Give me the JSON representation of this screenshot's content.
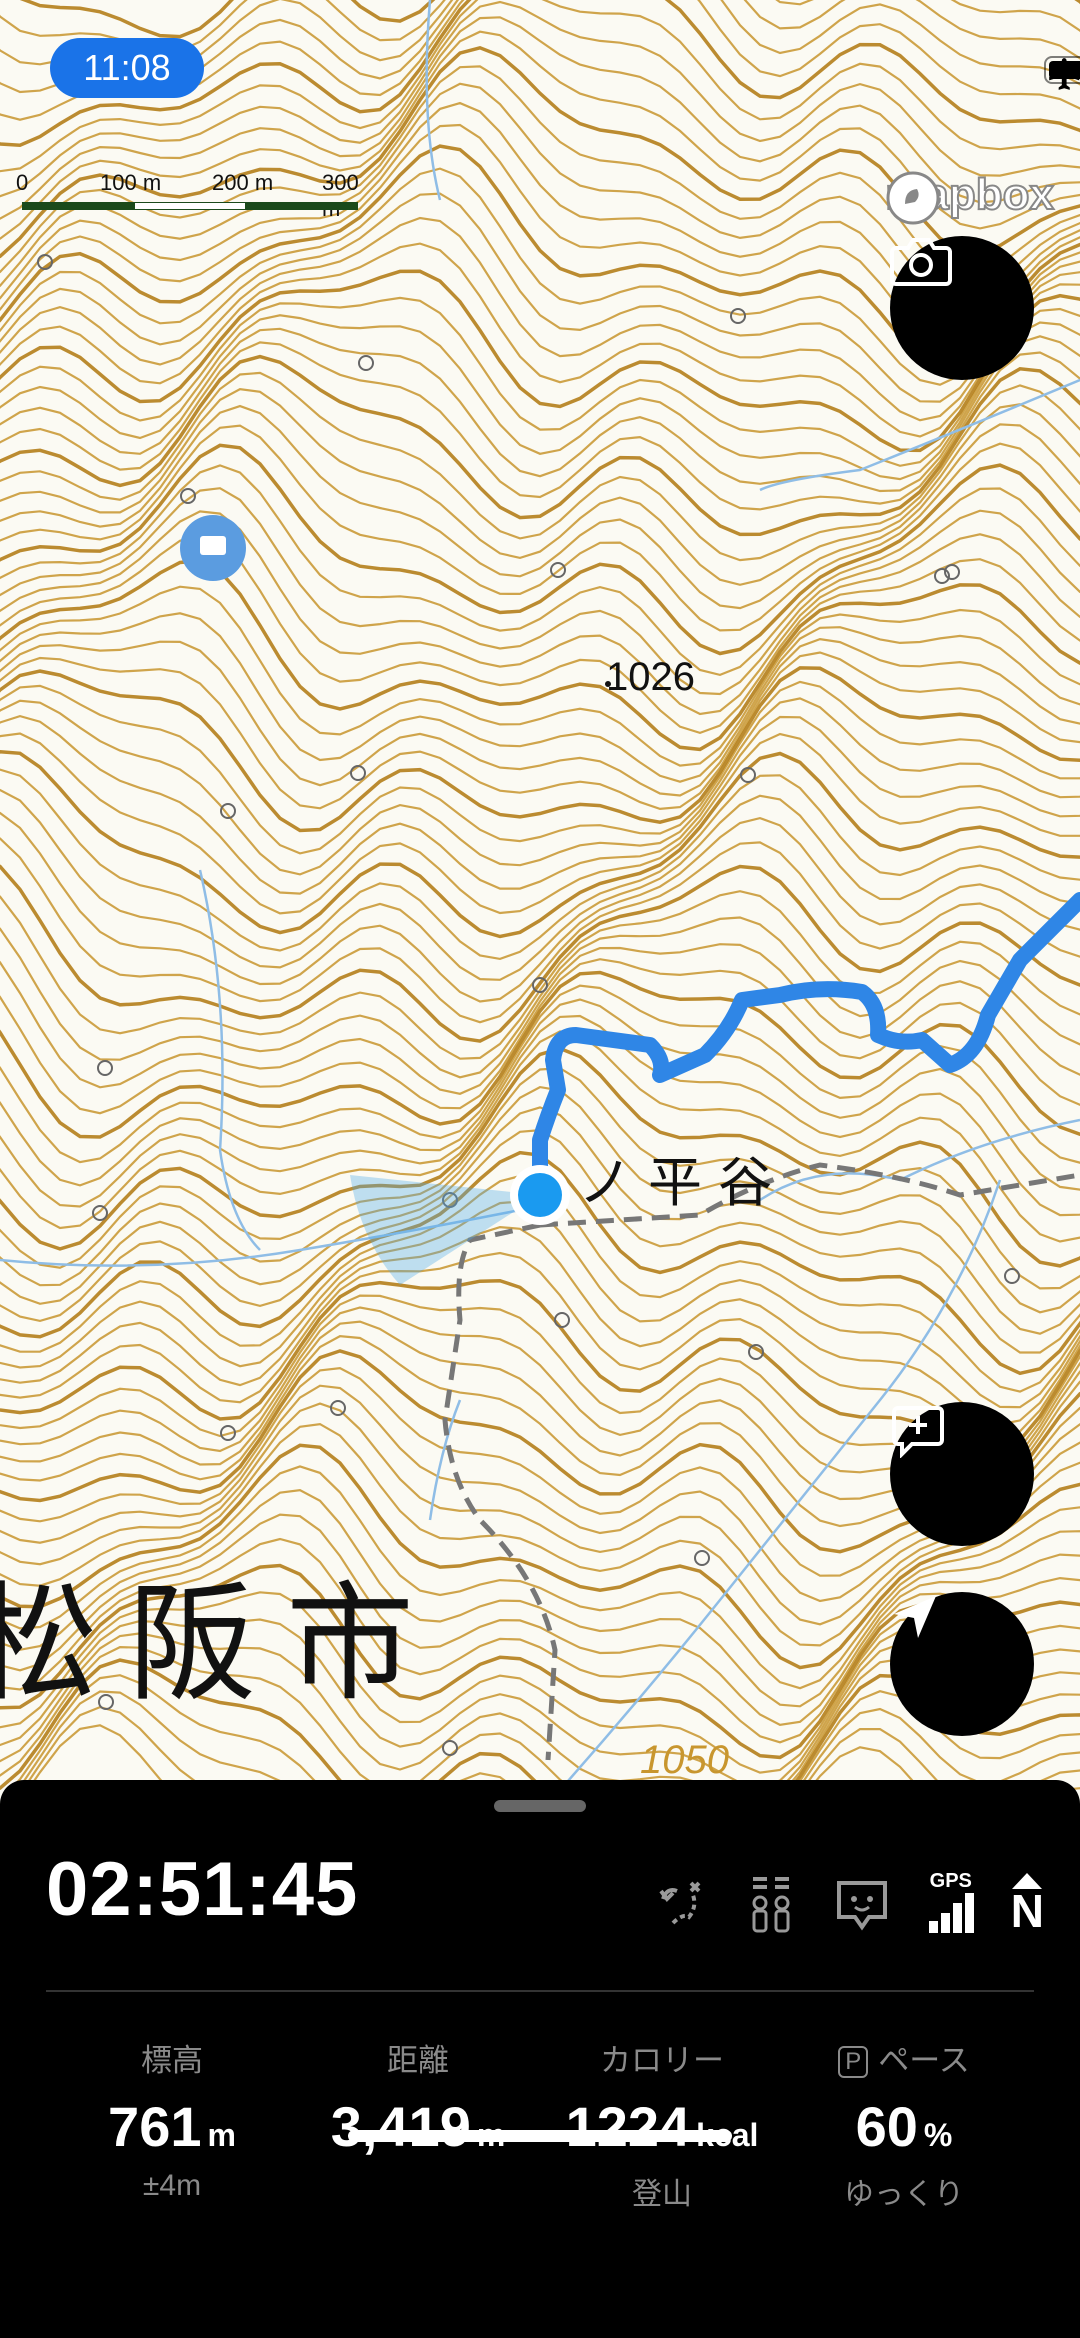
{
  "status_bar": {
    "time": "11:08",
    "icons": [
      "airplane-mode-icon",
      "battery-icon"
    ]
  },
  "scale_bar": {
    "labels": [
      "0",
      "100 m",
      "200 m",
      "300 m"
    ]
  },
  "map": {
    "attribution": "mapbox",
    "labels": {
      "elevation_point": "1026",
      "valley_name": "ノ平谷",
      "city_name": "松阪市",
      "contour_label": "1050"
    },
    "colors": {
      "contour": "#c8962e",
      "route": "#2f86e6",
      "trail": "#777777",
      "stream": "#8fbde6",
      "location": "#1a9af0"
    }
  },
  "buttons": {
    "camera": "camera-icon",
    "add_note": "add-note-icon",
    "locate": "location-arrow-icon"
  },
  "tracking_panel": {
    "elapsed_time": "02:51:45",
    "icons": [
      "route-icon",
      "signal-icon",
      "pet-icon",
      "gps-icon",
      "north-icon"
    ],
    "gps_label": "GPS",
    "north_label": "N",
    "stats": [
      {
        "label": "標高",
        "value": "761",
        "unit": "m",
        "sub": "±4m"
      },
      {
        "label": "距離",
        "value": "3,419",
        "unit": "m",
        "sub": ""
      },
      {
        "label": "カロリー",
        "value": "1224",
        "unit": "kcal",
        "sub": "登山"
      },
      {
        "label": "ペース",
        "value": "60",
        "unit": "%",
        "sub": "ゆっくり",
        "badge": "P"
      }
    ]
  }
}
